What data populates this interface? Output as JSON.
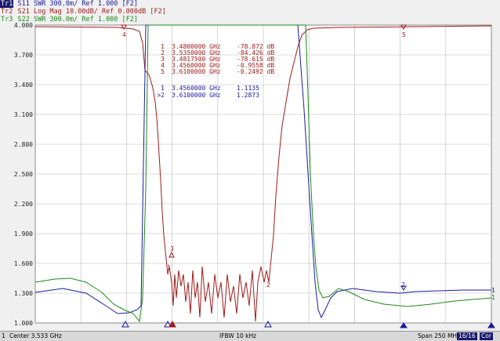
{
  "header": {
    "traces": [
      {
        "tag": "Tr1",
        "text": "S11 SWR 300.0m/ Ref 1.000 [F2]",
        "color": "#1a1aa0",
        "active": true
      },
      {
        "tag": "Tr2",
        "text": "S21 Log Mag 10.00dB/ Ref 0.000dB [F2]",
        "color": "#a01a1a",
        "active": false
      },
      {
        "tag": "Tr3",
        "text": "S22 SWR 300.0m/ Ref 1.000 [F2]",
        "color": "#1a8a1a",
        "active": false
      }
    ]
  },
  "y_ticks": [
    "4.000",
    "3.700",
    "3.400",
    "3.100",
    "2.800",
    "2.500",
    "2.200",
    "1.900",
    "1.600",
    "1.300",
    "1.000"
  ],
  "marker_table_s21": [
    {
      "n": "1",
      "freq": "3.4800000 GHz",
      "val": "-78.872 dB"
    },
    {
      "n": "2",
      "freq": "3.5350000 GHz",
      "val": "-84.426 dB"
    },
    {
      "n": "3",
      "freq": "3.4817500 GHz",
      "val": "-78.615 dB"
    },
    {
      "n": "4",
      "freq": "3.4560000 GHz",
      "val": "-0.9558 dB"
    },
    {
      "n": "5",
      "freq": "3.6100000 GHz",
      "val": "-0.2492 dB"
    }
  ],
  "marker_table_s11": [
    {
      "n": "1",
      "freq": "3.4560000 GHz",
      "val": "1.1135"
    },
    {
      "n": ">2",
      "freq": "3.6100000 GHz",
      "val": "1.2873"
    }
  ],
  "marker_labels": {
    "m1": "1",
    "m2": "2",
    "m3": "3",
    "m4": "4",
    "m5": "5"
  },
  "right_labels": {
    "s11": "1",
    "s22": "1"
  },
  "status": {
    "channel": "1",
    "center": "Center 3.533 GHz",
    "ifbw": "IFBW 10 kHz",
    "span": "Span 250 MHz",
    "count": "16/16",
    "cor": "Cor"
  },
  "colors": {
    "s11": "#1a1aa0",
    "s21": "#a01a1a",
    "s22": "#1a8a1a",
    "grid": "#b8b8b8",
    "plot_bg": "#ffffff"
  }
}
